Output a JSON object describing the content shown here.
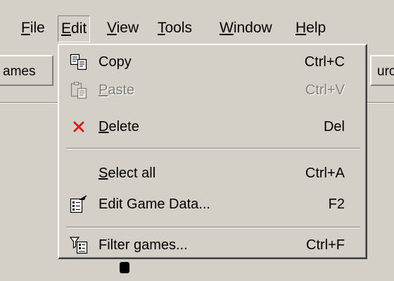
{
  "menubar": {
    "items": [
      {
        "label": "File",
        "mnemonic": "F",
        "rest": "ile"
      },
      {
        "label": "Edit",
        "mnemonic": "E",
        "rest": "dit"
      },
      {
        "label": "View",
        "mnemonic": "V",
        "rest": "iew"
      },
      {
        "label": "Tools",
        "mnemonic": "T",
        "rest": "ools"
      },
      {
        "label": "Window",
        "mnemonic": "W",
        "rest": "indow"
      },
      {
        "label": "Help",
        "mnemonic": "H",
        "rest": "elp"
      }
    ]
  },
  "background": {
    "left_tab_label": "ames",
    "right_tab_label": "urc"
  },
  "edit_menu": {
    "items": [
      {
        "label": "Copy",
        "shortcut": "Ctrl+C",
        "icon": "copy-icon",
        "enabled": true
      },
      {
        "label": "Paste",
        "mnemonic": "P",
        "rest": "aste",
        "shortcut": "Ctrl+V",
        "icon": "paste-icon",
        "enabled": false
      },
      {
        "label": "Delete",
        "mnemonic": "D",
        "rest": "elete",
        "shortcut": "Del",
        "icon": "delete-icon",
        "enabled": true
      },
      {
        "label": "Select all",
        "mnemonic": "S",
        "rest": "elect all",
        "shortcut": "Ctrl+A",
        "enabled": true
      },
      {
        "label": "Edit Game Data...",
        "shortcut": "F2",
        "icon": "edit-game-data-icon",
        "enabled": true
      },
      {
        "label": "Filter games...",
        "shortcut": "Ctrl+F",
        "icon": "filter-icon",
        "enabled": true
      }
    ]
  },
  "colors": {
    "face": "#d4d0c8",
    "shadow": "#808080",
    "highlight": "#ffffff",
    "delete_icon": "#d42020"
  }
}
